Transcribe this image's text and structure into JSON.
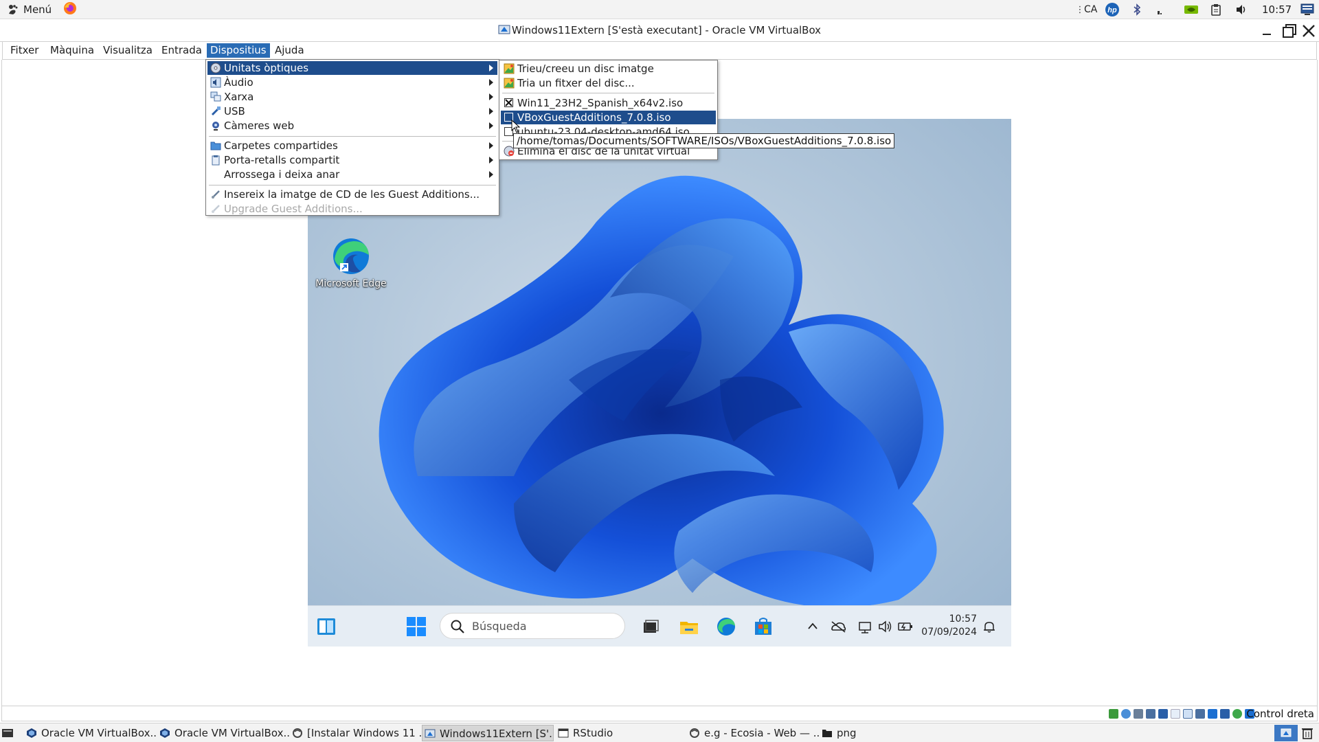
{
  "host_panel": {
    "menu_label": "Menú",
    "keyboard_layout": "CA",
    "clock": "10:57",
    "icons": [
      "gnome-foot-icon",
      "firefox-icon",
      "hp-icon",
      "bluetooth-icon",
      "network-signal-icon",
      "nvidia-icon",
      "clipboard-icon",
      "volume-icon",
      "tray-desktop-icon"
    ]
  },
  "vbox": {
    "title": "Windows11Extern [S'està executant] - Oracle VM VirtualBox",
    "menubar": [
      "Fitxer",
      "Màquina",
      "Visualitza",
      "Entrada",
      "Dispositius",
      "Ajuda"
    ],
    "active_menu": "Dispositius",
    "devices_menu": {
      "items": [
        {
          "label": "Unitats òptiques",
          "icon": "optical-disc-icon",
          "submenu": true,
          "highlighted": true
        },
        {
          "label": "Àudio",
          "icon": "audio-icon",
          "submenu": true
        },
        {
          "label": "Xarxa",
          "icon": "network-icon",
          "submenu": true
        },
        {
          "label": "USB",
          "icon": "usb-icon",
          "submenu": true
        },
        {
          "label": "Càmeres web",
          "icon": "webcam-icon",
          "submenu": true
        },
        {
          "label": "Carpetes compartides",
          "icon": "shared-folder-icon",
          "submenu": true
        },
        {
          "label": "Porta-retalls compartit",
          "icon": "clipboard-icon",
          "submenu": true
        },
        {
          "label": "Arrossega i deixa anar",
          "icon": "drag-drop-icon",
          "submenu": true
        },
        {
          "label": "Insereix la imatge de CD de les Guest Additions...",
          "icon": "guest-additions-icon",
          "submenu": false
        },
        {
          "label": "Upgrade Guest Additions...",
          "icon": "guest-additions-icon",
          "submenu": false,
          "disabled": true
        }
      ]
    },
    "optical_submenu": {
      "items": [
        {
          "label": "Trieu/creeu un disc imatge",
          "icon": "disc-image-icon"
        },
        {
          "label": "Tria un fitxer del disc...",
          "icon": "disc-file-icon"
        },
        {
          "label": "Win11_23H2_Spanish_x64v2.iso",
          "checked": true
        },
        {
          "label": "VBoxGuestAdditions_7.0.8.iso",
          "checked": false,
          "highlighted": true
        },
        {
          "label": "ubuntu-23.04-desktop-amd64.iso",
          "checked": false
        },
        {
          "label": "Elimina el disc de la unitat virtual",
          "icon": "eject-disc-icon"
        }
      ],
      "tooltip": "/home/tomas/Documents/SOFTWARE/ISOs/VBoxGuestAdditions_7.0.8.iso"
    },
    "status_bar": {
      "host_key": "Control dreta"
    }
  },
  "guest": {
    "desktop_icon_label": "Microsoft Edge",
    "search_placeholder": "Búsqueda",
    "time": "10:57",
    "date": "07/09/2024"
  },
  "host_taskbar": {
    "tasks": [
      {
        "label": "Oracle VM VirtualBox...",
        "icon": "virtualbox-icon"
      },
      {
        "label": "Oracle VM VirtualBox...",
        "icon": "virtualbox-icon"
      },
      {
        "label": "[Instalar Windows 11 ...",
        "icon": "firefox-icon"
      },
      {
        "label": "Windows11Extern [S'...",
        "icon": "virtualbox-icon",
        "active": true
      },
      {
        "label": "RStudio",
        "icon": "window-icon"
      },
      {
        "label": "e.g - Ecosia - Web — ...",
        "icon": "firefox-icon"
      },
      {
        "label": "png",
        "icon": "folder-icon"
      }
    ]
  }
}
